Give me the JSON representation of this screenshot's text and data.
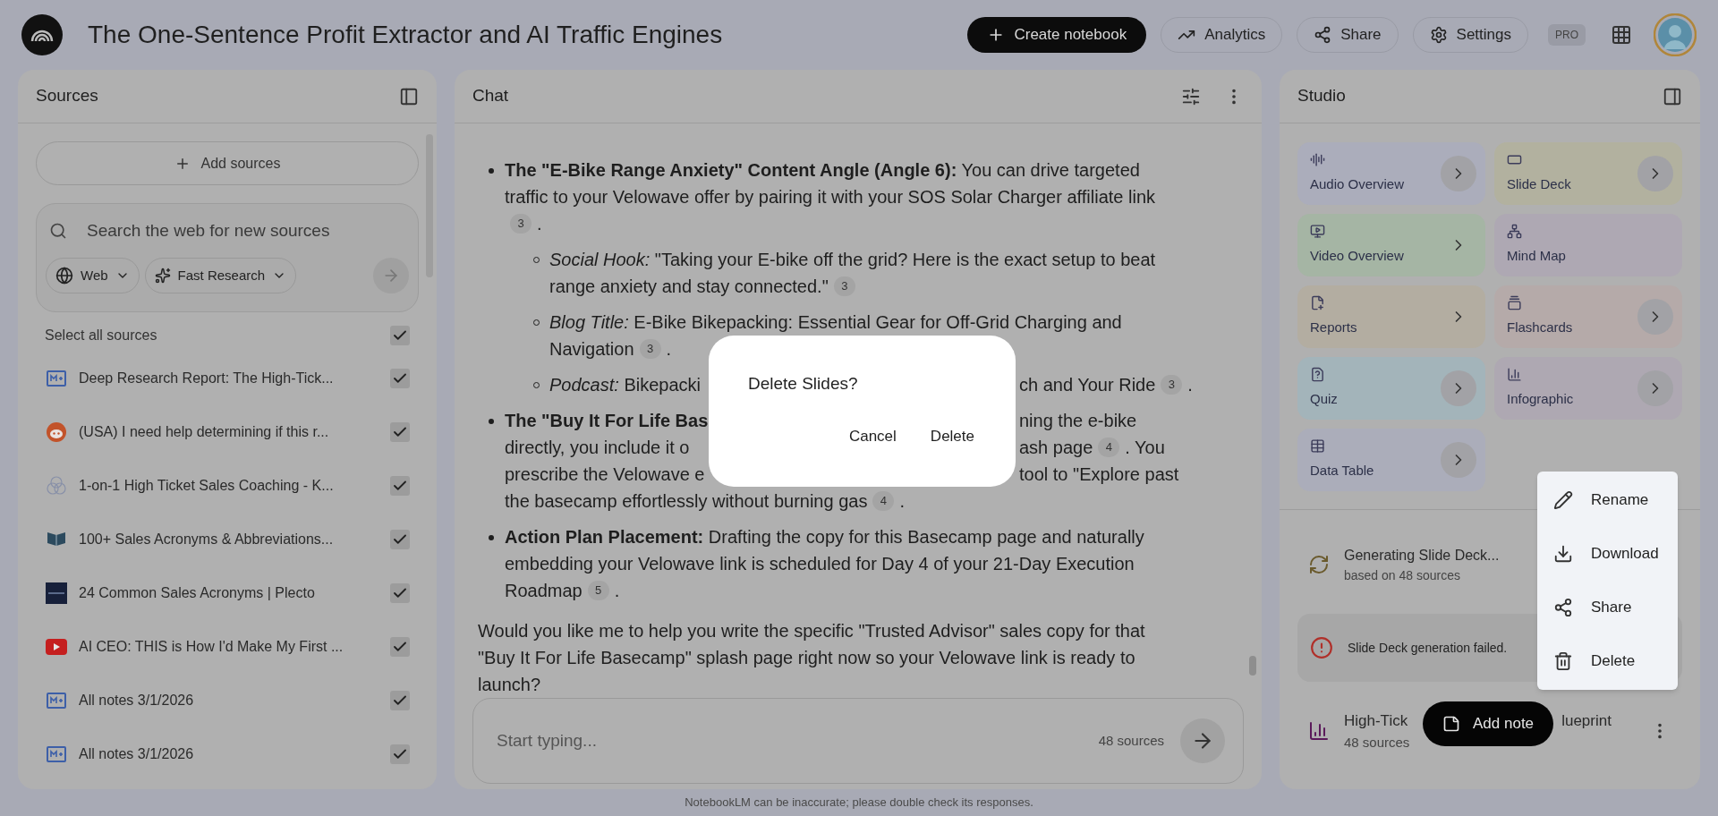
{
  "header": {
    "title": "The One-Sentence Profit Extractor and AI Traffic Engines",
    "buttons": [
      {
        "kind": "create",
        "label": "Create notebook"
      },
      {
        "kind": "analytics",
        "label": "Analytics"
      },
      {
        "kind": "share",
        "label": "Share"
      },
      {
        "kind": "settings",
        "label": "Settings"
      }
    ],
    "badge": "PRO"
  },
  "sources": {
    "title": "Sources",
    "add_button": "Add sources",
    "search": {
      "placeholder": "Search the web for new sources",
      "chips": [
        {
          "kind": "web",
          "label": "Web"
        },
        {
          "kind": "research",
          "label": "Fast Research"
        }
      ]
    },
    "select_all": {
      "label": "Select all sources",
      "checked": true
    },
    "items": [
      {
        "kind": "notes",
        "title": "Deep Research Report: The High-Tick...",
        "checked": true
      },
      {
        "kind": "reddit",
        "title": "(USA) I need help determining if this r...",
        "checked": true
      },
      {
        "kind": "rings",
        "title": "1-on-1 High Ticket Sales Coaching - K...",
        "checked": true
      },
      {
        "kind": "book",
        "title": "100+ Sales Acronyms & Abbreviations...",
        "checked": true
      },
      {
        "kind": "tile",
        "title": "24 Common Sales Acronyms | Plecto",
        "checked": true
      },
      {
        "kind": "video",
        "title": "AI CEO: THIS is How I'd Make My First ...",
        "checked": true
      },
      {
        "kind": "notes",
        "title": "All notes 3/1/2026",
        "checked": true
      },
      {
        "kind": "notes",
        "title": "All notes 3/1/2026",
        "checked": true
      }
    ]
  },
  "chat": {
    "title": "Chat",
    "lines": [
      {
        "kind": "bullet",
        "left": [
          {
            "kind": "text",
            "text": "**The \"E-Bike Range Anxiety\" Content Angle (Angle 6):** You can drive targeted"
          }
        ]
      },
      {
        "kind": "cont",
        "left": [
          {
            "kind": "text",
            "text": "traffic to your Velowave offer by pairing it with your SOS Solar Charger affiliate link"
          }
        ]
      },
      {
        "kind": "cont",
        "left": [
          {
            "kind": "cite",
            "text": "3"
          },
          {
            "kind": "text",
            "text": "."
          }
        ]
      },
      {
        "kind": "sub",
        "left": [
          {
            "kind": "text",
            "text": "*Social Hook:* \"Taking your E-bike off the grid? Here is the exact setup to beat"
          }
        ]
      },
      {
        "kind": "subcont",
        "left": [
          {
            "kind": "text",
            "text": "range anxiety and stay connected.\""
          },
          {
            "kind": "cite",
            "text": "3"
          }
        ]
      },
      {
        "kind": "sub",
        "left": [
          {
            "kind": "text",
            "text": "*Blog Title:* E-Bike Bikepacking: Essential Gear for Off-Grid Charging and"
          }
        ]
      },
      {
        "kind": "subcont",
        "left": [
          {
            "kind": "text",
            "text": "Navigation"
          },
          {
            "kind": "cite",
            "text": "3"
          },
          {
            "kind": "text",
            "text": "."
          }
        ]
      },
      {
        "kind": "sub",
        "left": [
          {
            "kind": "text",
            "text": "*Podcast:* Bikepacki"
          }
        ],
        "right": [
          {
            "kind": "text",
            "text": "ch and Your Ride"
          },
          {
            "kind": "cite",
            "text": "3"
          },
          {
            "kind": "text",
            "text": "."
          }
        ]
      },
      {
        "kind": "bullet",
        "left": [
          {
            "kind": "text",
            "text": "**The \"Buy It For Life Bas**"
          }
        ],
        "right": [
          {
            "kind": "text",
            "text": "ning the e-bike"
          }
        ]
      },
      {
        "kind": "cont",
        "left": [
          {
            "kind": "text",
            "text": "directly, you include it o"
          }
        ],
        "right": [
          {
            "kind": "text",
            "text": "ash page"
          },
          {
            "kind": "cite",
            "text": "4"
          },
          {
            "kind": "text",
            "text": ". You"
          }
        ]
      },
      {
        "kind": "cont",
        "left": [
          {
            "kind": "text",
            "text": "prescribe the Velowave e"
          }
        ],
        "right": [
          {
            "kind": "text",
            "text": "tool to \"Explore past"
          }
        ]
      },
      {
        "kind": "cont",
        "left": [
          {
            "kind": "text",
            "text": "the basecamp effortlessly without burning gas"
          },
          {
            "kind": "cite",
            "text": "4"
          },
          {
            "kind": "text",
            "text": "."
          }
        ]
      },
      {
        "kind": "bullet",
        "left": [
          {
            "kind": "text",
            "text": "**Action Plan Placement:** Drafting the copy for this Basecamp page and naturally"
          }
        ]
      },
      {
        "kind": "cont",
        "left": [
          {
            "kind": "text",
            "text": "embedding your Velowave link is scheduled for Day 4 of your 21-Day Execution"
          }
        ]
      },
      {
        "kind": "cont",
        "left": [
          {
            "kind": "text",
            "text": "Roadmap"
          },
          {
            "kind": "cite",
            "text": "5"
          },
          {
            "kind": "text",
            "text": "."
          }
        ]
      },
      {
        "kind": "para",
        "left": [
          {
            "kind": "text",
            "text": "Would you like me to help you write the specific \"Trusted Advisor\" sales copy for that"
          }
        ]
      },
      {
        "kind": "cont0",
        "left": [
          {
            "kind": "text",
            "text": "\"Buy It For Life Basecamp\" splash page right now so your Velowave link is ready to"
          }
        ]
      },
      {
        "kind": "cont0",
        "left": [
          {
            "kind": "text",
            "text": "launch?"
          }
        ]
      }
    ],
    "input": {
      "placeholder": "Start typing...",
      "count": "48 sources"
    }
  },
  "studio": {
    "title": "Studio",
    "tiles": [
      {
        "kind": "audio",
        "label": "Audio Overview",
        "color": "#abadbb",
        "chevron": true,
        "circled": true
      },
      {
        "kind": "slides",
        "label": "Slide Deck",
        "color": "#b2b19f",
        "chevron": true,
        "circled": true
      },
      {
        "kind": "video",
        "label": "Video Overview",
        "color": "#a5b5a4",
        "chevron": true,
        "circled": false
      },
      {
        "kind": "mindmap",
        "label": "Mind Map",
        "color": "#aea8b3",
        "chevron": false
      },
      {
        "kind": "reports",
        "label": "Reports",
        "color": "#b3ada1",
        "chevron": true,
        "circled": false
      },
      {
        "kind": "flashcards",
        "label": "Flashcards",
        "color": "#b5aaa9",
        "chevron": true,
        "circled": true
      },
      {
        "kind": "quiz",
        "label": "Quiz",
        "color": "#a3b4ba",
        "chevron": true,
        "circled": true
      },
      {
        "kind": "infographic",
        "label": "Infographic",
        "color": "#aea8b2",
        "chevron": true,
        "circled": true
      },
      {
        "kind": "table",
        "label": "Data Table",
        "color": "#abadba",
        "chevron": true,
        "circled": true
      }
    ],
    "artifacts": [
      {
        "kind": "generating",
        "title": "Generating Slide Deck...",
        "subtitle": "based on 48 sources"
      },
      {
        "kind": "failed",
        "title": "Slide Deck generation failed."
      },
      {
        "kind": "infographic",
        "title_parts": [
          "High-Tick",
          "lueprint"
        ],
        "subtitle": "48 sources"
      }
    ],
    "add_note": "Add note"
  },
  "menu": [
    {
      "kind": "rename",
      "label": "Rename"
    },
    {
      "kind": "download",
      "label": "Download"
    },
    {
      "kind": "share",
      "label": "Share"
    },
    {
      "kind": "delete",
      "label": "Delete"
    }
  ],
  "dialog": {
    "title": "Delete Slides?",
    "buttons": [
      "Cancel",
      "Delete"
    ]
  },
  "footer": "NotebookLM can be inaccurate; please double check its responses."
}
